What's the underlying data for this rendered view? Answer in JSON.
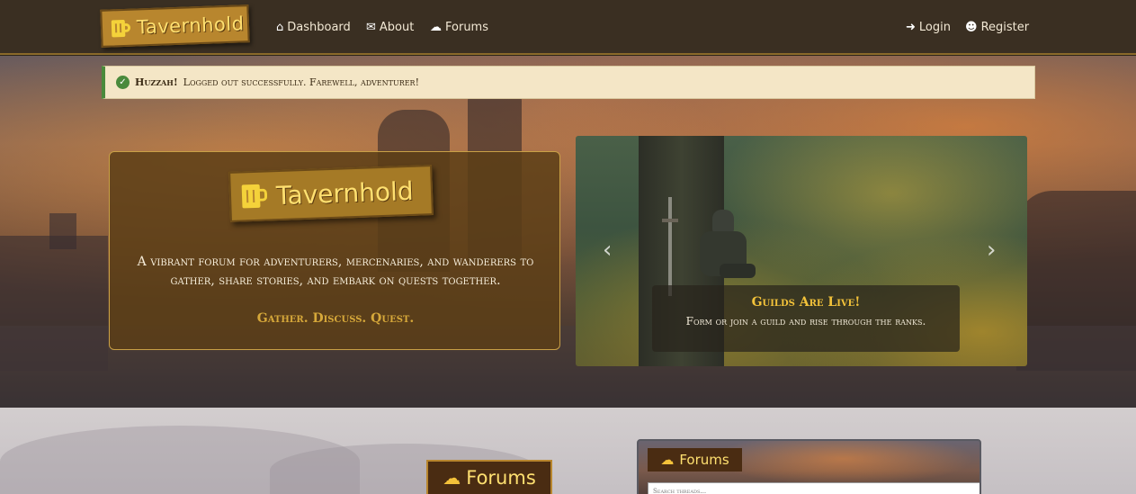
{
  "nav": {
    "brand": "Tavernhold",
    "links": [
      {
        "label": "Dashboard",
        "icon": "home-icon"
      },
      {
        "label": "About",
        "icon": "scroll-icon"
      },
      {
        "label": "Forums",
        "icon": "comments-icon"
      }
    ],
    "auth": [
      {
        "label": "Login",
        "icon": "login-icon"
      },
      {
        "label": "Register",
        "icon": "user-plus-icon"
      }
    ]
  },
  "alert": {
    "strong": "Huzzah!",
    "message": "Logged out successfully. Farewell, adventurer!",
    "icon": "check-circle-icon",
    "color": "#4a8a3c"
  },
  "intro": {
    "brand": "Tavernhold",
    "description": "A vibrant forum for adventurers, mercenaries, and wanderers to gather, share stories, and embark on quests together.",
    "tagline": "Gather. Discuss. Quest."
  },
  "carousel": {
    "title": "Guilds Are Live!",
    "text": "Form or join a guild and rise through the ranks.",
    "prev_icon": "chevron-left-icon",
    "next_icon": "chevron-right-icon"
  },
  "forums": {
    "heading": "Forums",
    "panel_tab": "Forums",
    "search_placeholder": "Search threads..."
  },
  "colors": {
    "navbar": "#3a2f22",
    "accent_gold": "#f4d23a",
    "brand_bg": "#b8862e"
  }
}
